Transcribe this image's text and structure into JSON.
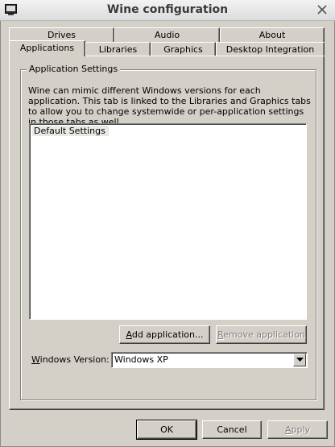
{
  "window": {
    "title": "Wine configuration",
    "icon": "wine-app-icon",
    "close_icon": "close-x-icon"
  },
  "tabs": {
    "row_back": [
      {
        "label": "Drives"
      },
      {
        "label": "Audio"
      },
      {
        "label": "About"
      }
    ],
    "row_front": [
      {
        "label": "Applications",
        "active": true
      },
      {
        "label": "Libraries"
      },
      {
        "label": "Graphics"
      },
      {
        "label": "Desktop Integration"
      }
    ]
  },
  "app_settings": {
    "group_label": "Application Settings",
    "description": "Wine can mimic different Windows versions for each application.  This tab is linked to the Libraries and Graphics tabs to allow you to change systemwide or per-application settings in those tabs as well.",
    "list_items": [
      "Default Settings"
    ],
    "add_button": {
      "label_prefix": "",
      "mnemonic": "A",
      "label_rest": "dd application...",
      "enabled": true
    },
    "remove_button": {
      "label_prefix": "",
      "mnemonic": "R",
      "label_rest": "emove application",
      "enabled": false
    },
    "windows_version": {
      "label_mnemonic": "W",
      "label_rest": "indows Version:",
      "value": "Windows XP"
    }
  },
  "footer": {
    "ok": "OK",
    "cancel": "Cancel",
    "apply_mnemonic": "A",
    "apply_rest": "pply"
  }
}
